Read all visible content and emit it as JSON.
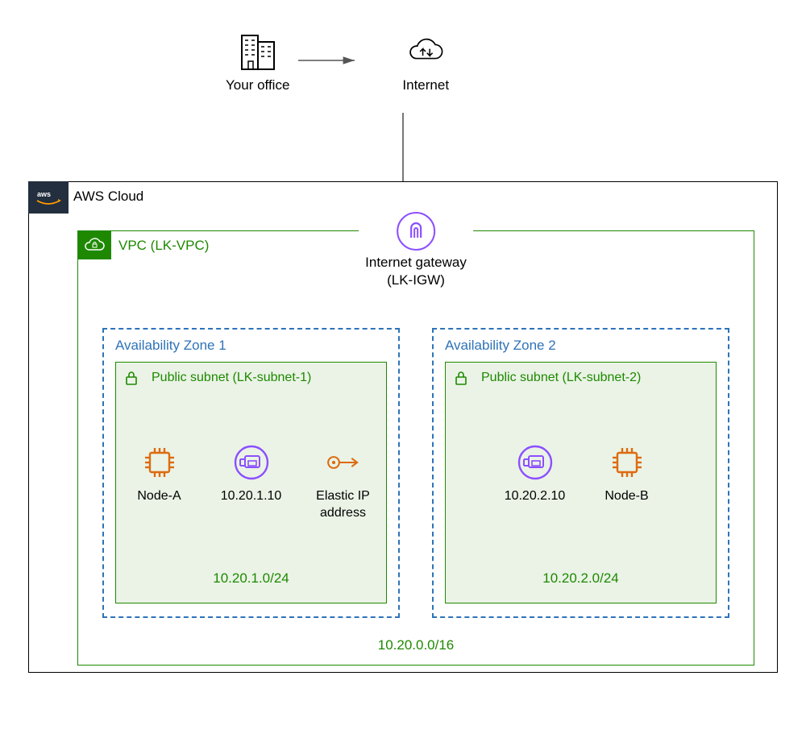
{
  "top": {
    "office_label": "Your office",
    "internet_label": "Internet"
  },
  "cloud": {
    "label": "AWS Cloud"
  },
  "vpc": {
    "label": "VPC (LK-VPC)",
    "cidr": "10.20.0.0/16"
  },
  "igw": {
    "label_line1": "Internet gateway",
    "label_line2": "(LK-IGW)"
  },
  "az1": {
    "label": "Availability Zone 1",
    "subnet_label": "Public subnet (LK-subnet-1)",
    "subnet_cidr": "10.20.1.0/24",
    "node_label": "Node-A",
    "eni_label": "10.20.1.10",
    "eip_label_line1": "Elastic IP",
    "eip_label_line2": "address"
  },
  "az2": {
    "label": "Availability Zone 2",
    "subnet_label": "Public subnet (LK-subnet-2)",
    "subnet_cidr": "10.20.2.0/24",
    "eni_label": "10.20.2.10",
    "node_label": "Node-B"
  },
  "colors": {
    "green": "#1e8900",
    "blue": "#2e73b8",
    "orange": "#dd6b10",
    "purple": "#8c4fff",
    "dark": "#232f3e"
  }
}
